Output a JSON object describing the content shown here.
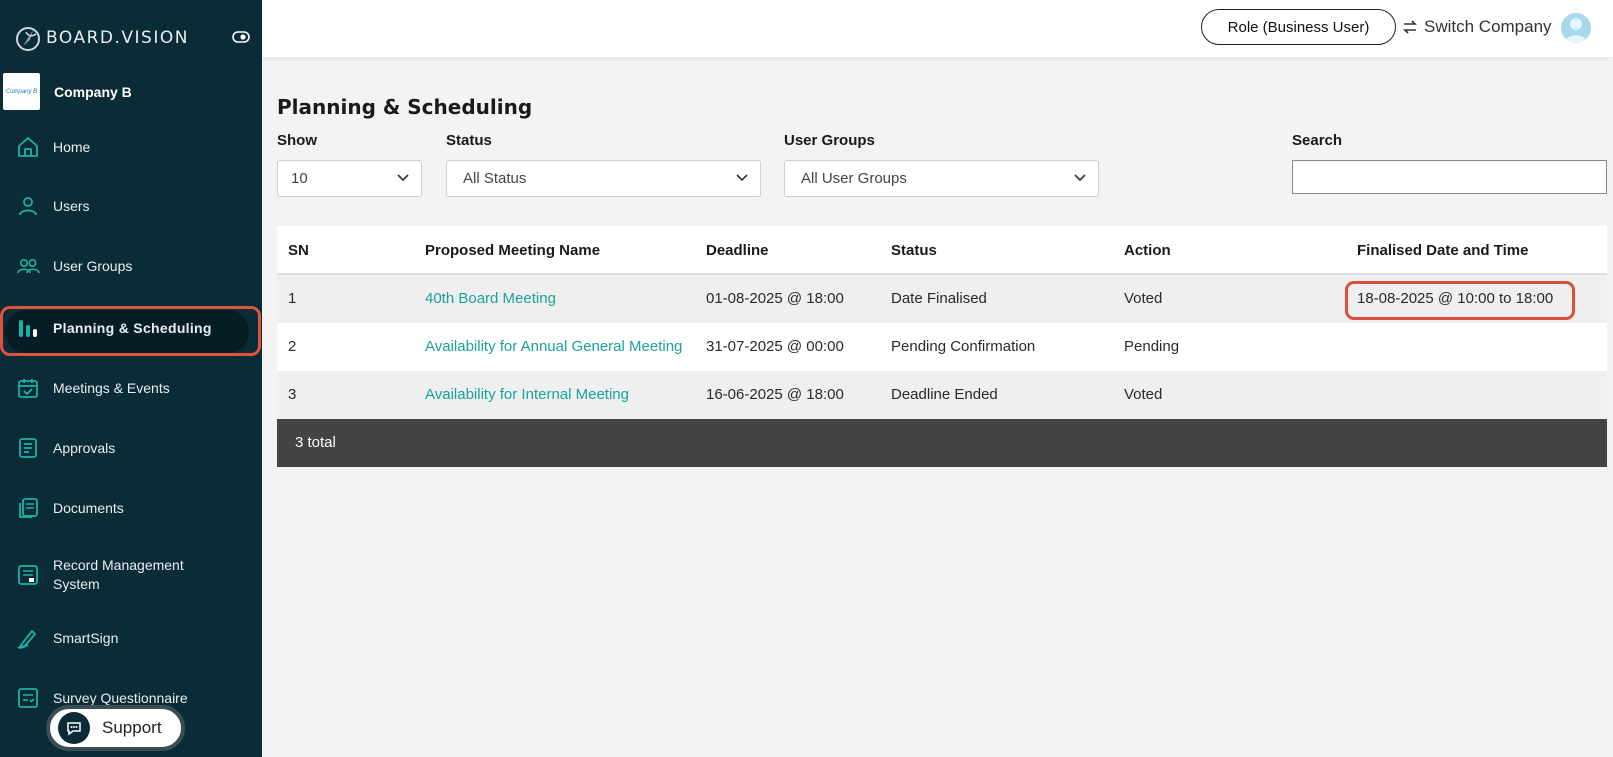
{
  "app": {
    "brand": "BOARD.VISION",
    "company": "Company B",
    "company_logo_text": "Company B"
  },
  "sidebar": {
    "items": [
      {
        "label": "Home",
        "icon": "home-icon"
      },
      {
        "label": "Users",
        "icon": "user-icon"
      },
      {
        "label": "User Groups",
        "icon": "users-icon"
      },
      {
        "label": "Planning & Scheduling",
        "icon": "bar-chart-icon",
        "active": true
      },
      {
        "label": "Meetings & Events",
        "icon": "calendar-check-icon"
      },
      {
        "label": "Approvals",
        "icon": "document-icon"
      },
      {
        "label": "Documents",
        "icon": "documents-icon"
      },
      {
        "label": "Record Management System",
        "icon": "records-icon"
      },
      {
        "label": "SmartSign",
        "icon": "pen-icon"
      },
      {
        "label": "Survey Questionnaire",
        "icon": "checklist-icon"
      }
    ],
    "support_label": "Support"
  },
  "topbar": {
    "role_label": "Role (Business User)",
    "switch_label": "Switch Company"
  },
  "main": {
    "title": "Planning & Scheduling",
    "filters": {
      "show_label": "Show",
      "show_value": "10",
      "status_label": "Status",
      "status_value": "All Status",
      "groups_label": "User Groups",
      "groups_value": "All User Groups",
      "search_label": "Search",
      "search_value": ""
    },
    "table": {
      "headers": [
        "SN",
        "Proposed Meeting Name",
        "Deadline",
        "Status",
        "Action",
        "Finalised Date and Time"
      ],
      "rows": [
        {
          "sn": "1",
          "name": "40th Board Meeting",
          "deadline": "01-08-2025 @ 18:00",
          "status": "Date Finalised",
          "action": "Voted",
          "finalised": "18-08-2025 @ 10:00 to 18:00"
        },
        {
          "sn": "2",
          "name": "Availability for Annual General Meeting",
          "deadline": "31-07-2025 @ 00:00",
          "status": "Pending Confirmation",
          "action": "Pending",
          "finalised": ""
        },
        {
          "sn": "3",
          "name": "Availability for Internal Meeting",
          "deadline": "16-06-2025 @ 18:00",
          "status": "Deadline Ended",
          "action": "Voted",
          "finalised": ""
        }
      ],
      "total": "3 total"
    }
  },
  "colors": {
    "sidebar_bg": "#0b2b36",
    "accent_link": "#1aa39a",
    "highlight": "#d8503b",
    "footer_bg": "#444444"
  }
}
